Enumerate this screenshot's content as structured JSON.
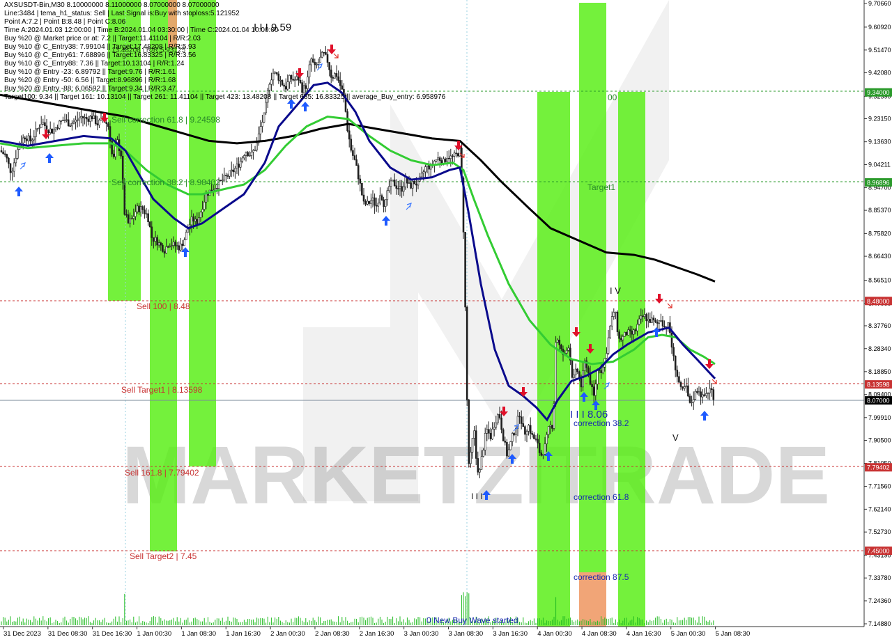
{
  "header": {
    "lines": [
      "AXSUSDT-Bin,M30  8.10000000 8.11000000 8.07000000 8.07000000",
      "Line:3484 | tema_h1_status: Sell | Last Signal is:Buy with stoploss:5.121952",
      "Point A:7.2 | Point B:8.48 | Point C:8.06",
      "Time A:2024.01.03 12:00:00 | Time B:2024.01.04 03:30:00 | Time C:2024.01.04 10:00:00",
      "Buy %20 @ Market price or at: 7.2 || Target:11.41104 | R/R:2.03",
      "Buy %10 @ C_Entry38: 7.99104 || Target:17.48208 | R/R:5.93",
      "Buy %10 @ C_Entry61: 7.68896 || Target:16.83325 | R/R:3.56",
      "Buy %10 @ C_Entry88: 7.36 || Target:10.13104 | R/R:1.24",
      "Buy %10 @ Entry -23: 6.89792 || Target:9.76 | R/R:1.61",
      "Buy %20 @ Entry -50: 6.56 || Target:8.96896 | R/R:1.68",
      "Buy %20 @ Entry -88: 6.06592 || Target:9.34 | R/R:3.47",
      "Target100: 9.34 || Target 161: 10.13104 || Target 261: 11.41104 || Target 423: 13.48208 || Target 685: 16.83325 || average_Buy_entry: 6.958976"
    ],
    "overlap_fragment": "13.48208 | R/R:5.93125"
  },
  "colors": {
    "bull_candle": "#1f1f1f",
    "bear_candle": "#1f1f1f",
    "ema_fast": "#0a0a8c",
    "ema_mid": "#33cc33",
    "ema_slow": "#000000",
    "green_zone": "#55ee11",
    "orange_zone": "#f0a070",
    "level_red": "#c83232",
    "level_green": "#2a9a2a",
    "buy_arrow": "#1e5aff",
    "sell_arrow": "#e0102a",
    "current_price_bg": "#000000"
  },
  "price_axis": {
    "ticks": [
      "9.70660",
      "9.60920",
      "9.51470",
      "9.42080",
      "9.32390",
      "9.23150",
      "9.13630",
      "9.04211",
      "8.94700",
      "8.85370",
      "8.75820",
      "8.66430",
      "8.56510",
      "8.47000",
      "8.37760",
      "8.28340",
      "8.18850",
      "8.09400",
      "7.99910",
      "7.90500",
      "7.81050",
      "7.71560",
      "7.62140",
      "7.52730",
      "7.43190",
      "7.33780",
      "7.24360",
      "7.14880"
    ],
    "badges": [
      {
        "label": "9.34000",
        "style": "green"
      },
      {
        "label": "8.96896",
        "style": "green"
      },
      {
        "label": "8.48000",
        "style": "red"
      },
      {
        "label": "8.13598",
        "style": "red"
      },
      {
        "label": "8.07000",
        "style": "black"
      },
      {
        "label": "7.79402",
        "style": "red"
      },
      {
        "label": "7.45000",
        "style": "red"
      }
    ]
  },
  "time_axis": {
    "labels": [
      "31 Dec 2023",
      "31 Dec 08:30",
      "31 Dec 16:30",
      "1 Jan 00:30",
      "1 Jan 08:30",
      "1 Jan 16:30",
      "2 Jan 00:30",
      "2 Jan 08:30",
      "2 Jan 16:30",
      "3 Jan 00:30",
      "3 Jan 08:30",
      "3 Jan 16:30",
      "4 Jan 00:30",
      "4 Jan 08:30",
      "4 Jan 16:30",
      "5 Jan 00:30",
      "5 Jan 08:30"
    ]
  },
  "annotations": {
    "sell_correction_618": "Sell correction 61.8 | 9.24598",
    "sell_correction_382": "Sell correction 38.2 | 8.98402",
    "sell_100": "Sell 100 | 8.48",
    "sell_target1": "Sell Target1 | 8.13598",
    "sell_1618": "Sell 161.8 | 7.79402",
    "sell_target2": "Sell Target2 | 7.45",
    "peak_label": "I I I 9.59",
    "target1": "Target1",
    "target_partial": "00",
    "point_c": "I I I 8.06",
    "correction_382": "correction 38.2",
    "correction_618": "correction 61.8",
    "correction_875": "correction 87.5",
    "new_wave": "0 New Buy Wave started",
    "marker_v_top": "I V",
    "marker_v_low": "V",
    "marker_iii_low": "I I I"
  },
  "watermark": "MARKETZITRADE",
  "chart_data": {
    "type": "candlestick",
    "symbol": "AXSUSDT-Bin",
    "timeframe": "M30",
    "ohlc_last": {
      "open": 8.1,
      "high": 8.11,
      "low": 8.07,
      "close": 8.07
    },
    "ylim": [
      7.1488,
      9.7066
    ],
    "levels": [
      {
        "name": "Target100",
        "value": 9.34
      },
      {
        "name": "Sell correction 61.8",
        "value": 9.24598
      },
      {
        "name": "Sell correction 38.2",
        "value": 8.98402
      },
      {
        "name": "Sell 100",
        "value": 8.48
      },
      {
        "name": "Sell Target1",
        "value": 8.13598
      },
      {
        "name": "Sell 161.8",
        "value": 7.79402
      },
      {
        "name": "Sell Target2",
        "value": 7.45
      }
    ],
    "close_path": [
      [
        0,
        9.1
      ],
      [
        8,
        9.08
      ],
      [
        16,
        9.01
      ],
      [
        22,
        9.07
      ],
      [
        28,
        9.13
      ],
      [
        36,
        9.16
      ],
      [
        44,
        9.14
      ],
      [
        52,
        9.18
      ],
      [
        60,
        9.22
      ],
      [
        68,
        9.19
      ],
      [
        76,
        9.18
      ],
      [
        84,
        9.21
      ],
      [
        92,
        9.23
      ],
      [
        100,
        9.21
      ],
      [
        108,
        9.22
      ],
      [
        116,
        9.24
      ],
      [
        124,
        9.23
      ],
      [
        132,
        9.24
      ],
      [
        140,
        9.21
      ],
      [
        148,
        9.23
      ],
      [
        156,
        9.2
      ],
      [
        162,
        9.05
      ],
      [
        168,
        9.14
      ],
      [
        174,
        9.08
      ],
      [
        178,
        8.85
      ],
      [
        184,
        8.8
      ],
      [
        190,
        8.82
      ],
      [
        196,
        8.86
      ],
      [
        204,
        8.86
      ],
      [
        212,
        8.83
      ],
      [
        218,
        8.74
      ],
      [
        224,
        8.73
      ],
      [
        230,
        8.71
      ],
      [
        236,
        8.69
      ],
      [
        242,
        8.72
      ],
      [
        250,
        8.71
      ],
      [
        258,
        8.7
      ],
      [
        264,
        8.73
      ],
      [
        270,
        8.78
      ],
      [
        276,
        8.82
      ],
      [
        282,
        8.8
      ],
      [
        288,
        8.85
      ],
      [
        296,
        8.92
      ],
      [
        304,
        8.94
      ],
      [
        312,
        8.96
      ],
      [
        320,
        8.98
      ],
      [
        328,
        9.0
      ],
      [
        336,
        9.02
      ],
      [
        344,
        9.05
      ],
      [
        352,
        9.1
      ],
      [
        360,
        9.08
      ],
      [
        368,
        9.12
      ],
      [
        374,
        9.2
      ],
      [
        380,
        9.25
      ],
      [
        386,
        9.38
      ],
      [
        392,
        9.42
      ],
      [
        398,
        9.41
      ],
      [
        404,
        9.38
      ],
      [
        410,
        9.36
      ],
      [
        416,
        9.4
      ],
      [
        422,
        9.39
      ],
      [
        428,
        9.4
      ],
      [
        434,
        9.35
      ],
      [
        440,
        9.37
      ],
      [
        446,
        9.48
      ],
      [
        452,
        9.44
      ],
      [
        458,
        9.47
      ],
      [
        464,
        9.5
      ],
      [
        470,
        9.47
      ],
      [
        476,
        9.4
      ],
      [
        482,
        9.42
      ],
      [
        488,
        9.37
      ],
      [
        494,
        9.32
      ],
      [
        498,
        9.2
      ],
      [
        504,
        9.1
      ],
      [
        510,
        9.05
      ],
      [
        516,
        8.97
      ],
      [
        522,
        8.88
      ],
      [
        528,
        8.88
      ],
      [
        534,
        8.9
      ],
      [
        540,
        8.87
      ],
      [
        546,
        8.93
      ],
      [
        552,
        8.87
      ],
      [
        558,
        8.95
      ],
      [
        564,
        8.97
      ],
      [
        570,
        8.95
      ],
      [
        576,
        8.94
      ],
      [
        582,
        8.98
      ],
      [
        588,
        8.95
      ],
      [
        594,
        8.97
      ],
      [
        600,
        8.96
      ],
      [
        606,
        9.0
      ],
      [
        612,
        9.04
      ],
      [
        618,
        9.03
      ],
      [
        624,
        9.06
      ],
      [
        630,
        9.07
      ],
      [
        636,
        9.05
      ],
      [
        642,
        9.08
      ],
      [
        648,
        9.07
      ],
      [
        654,
        9.08
      ],
      [
        660,
        9.1
      ],
      [
        664,
        8.9
      ],
      [
        668,
        8.4
      ],
      [
        672,
        7.8
      ],
      [
        676,
        7.85
      ],
      [
        680,
        7.96
      ],
      [
        684,
        7.8
      ],
      [
        688,
        7.77
      ],
      [
        692,
        7.85
      ],
      [
        698,
        7.95
      ],
      [
        704,
        7.92
      ],
      [
        710,
        7.98
      ],
      [
        716,
        8.02
      ],
      [
        722,
        7.92
      ],
      [
        728,
        7.84
      ],
      [
        734,
        7.91
      ],
      [
        740,
        7.96
      ],
      [
        746,
        8.02
      ],
      [
        752,
        7.93
      ],
      [
        758,
        7.97
      ],
      [
        764,
        7.92
      ],
      [
        770,
        7.9
      ],
      [
        776,
        7.84
      ],
      [
        782,
        7.88
      ],
      [
        788,
        7.96
      ],
      [
        794,
        7.97
      ],
      [
        798,
        8.35
      ],
      [
        804,
        8.28
      ],
      [
        810,
        8.25
      ],
      [
        816,
        8.3
      ],
      [
        822,
        8.15
      ],
      [
        828,
        8.2
      ],
      [
        834,
        8.13
      ],
      [
        840,
        8.24
      ],
      [
        846,
        8.16
      ],
      [
        852,
        8.08
      ],
      [
        858,
        8.21
      ],
      [
        864,
        8.19
      ],
      [
        870,
        8.27
      ],
      [
        876,
        8.38
      ],
      [
        882,
        8.45
      ],
      [
        888,
        8.32
      ],
      [
        894,
        8.33
      ],
      [
        900,
        8.35
      ],
      [
        906,
        8.34
      ],
      [
        912,
        8.36
      ],
      [
        918,
        8.4
      ],
      [
        924,
        8.42
      ],
      [
        930,
        8.4
      ],
      [
        936,
        8.4
      ],
      [
        942,
        8.38
      ],
      [
        948,
        8.41
      ],
      [
        954,
        8.37
      ],
      [
        960,
        8.38
      ],
      [
        966,
        8.25
      ],
      [
        972,
        8.17
      ],
      [
        978,
        8.1
      ],
      [
        984,
        8.13
      ],
      [
        990,
        8.05
      ],
      [
        996,
        8.09
      ],
      [
        1002,
        8.12
      ],
      [
        1008,
        8.08
      ],
      [
        1014,
        8.1
      ],
      [
        1020,
        8.12
      ],
      [
        1026,
        8.07
      ]
    ],
    "ema_fast_path": [
      [
        0,
        9.14
      ],
      [
        40,
        9.12
      ],
      [
        80,
        9.14
      ],
      [
        120,
        9.16
      ],
      [
        160,
        9.15
      ],
      [
        180,
        9.1
      ],
      [
        200,
        9.0
      ],
      [
        220,
        8.9
      ],
      [
        250,
        8.82
      ],
      [
        270,
        8.78
      ],
      [
        290,
        8.8
      ],
      [
        320,
        8.86
      ],
      [
        350,
        8.92
      ],
      [
        380,
        9.05
      ],
      [
        400,
        9.2
      ],
      [
        430,
        9.3
      ],
      [
        450,
        9.37
      ],
      [
        470,
        9.38
      ],
      [
        490,
        9.34
      ],
      [
        510,
        9.26
      ],
      [
        530,
        9.14
      ],
      [
        560,
        9.03
      ],
      [
        590,
        8.98
      ],
      [
        620,
        8.99
      ],
      [
        645,
        9.02
      ],
      [
        660,
        9.03
      ],
      [
        672,
        8.85
      ],
      [
        690,
        8.55
      ],
      [
        710,
        8.28
      ],
      [
        730,
        8.13
      ],
      [
        750,
        8.09
      ],
      [
        770,
        8.04
      ],
      [
        785,
        7.99
      ],
      [
        800,
        8.07
      ],
      [
        820,
        8.15
      ],
      [
        840,
        8.17
      ],
      [
        860,
        8.2
      ],
      [
        880,
        8.26
      ],
      [
        900,
        8.3
      ],
      [
        930,
        8.35
      ],
      [
        960,
        8.37
      ],
      [
        980,
        8.3
      ],
      [
        1000,
        8.24
      ],
      [
        1026,
        8.16
      ]
    ],
    "ema_mid_path": [
      [
        0,
        9.13
      ],
      [
        40,
        9.11
      ],
      [
        80,
        9.12
      ],
      [
        120,
        9.13
      ],
      [
        160,
        9.13
      ],
      [
        180,
        9.1
      ],
      [
        210,
        9.02
      ],
      [
        240,
        8.96
      ],
      [
        270,
        8.92
      ],
      [
        290,
        8.92
      ],
      [
        320,
        8.94
      ],
      [
        350,
        8.96
      ],
      [
        380,
        9.02
      ],
      [
        410,
        9.12
      ],
      [
        440,
        9.2
      ],
      [
        470,
        9.24
      ],
      [
        500,
        9.23
      ],
      [
        530,
        9.16
      ],
      [
        560,
        9.1
      ],
      [
        590,
        9.06
      ],
      [
        620,
        9.04
      ],
      [
        650,
        9.05
      ],
      [
        665,
        9.02
      ],
      [
        680,
        8.9
      ],
      [
        700,
        8.75
      ],
      [
        730,
        8.55
      ],
      [
        760,
        8.4
      ],
      [
        790,
        8.3
      ],
      [
        820,
        8.24
      ],
      [
        850,
        8.22
      ],
      [
        880,
        8.23
      ],
      [
        910,
        8.28
      ],
      [
        930,
        8.33
      ],
      [
        950,
        8.34
      ],
      [
        970,
        8.33
      ],
      [
        990,
        8.28
      ],
      [
        1010,
        8.25
      ],
      [
        1026,
        8.22
      ]
    ],
    "ema_slow_path": [
      [
        0,
        9.33
      ],
      [
        60,
        9.3
      ],
      [
        120,
        9.27
      ],
      [
        180,
        9.24
      ],
      [
        240,
        9.19
      ],
      [
        300,
        9.14
      ],
      [
        340,
        9.13
      ],
      [
        380,
        9.14
      ],
      [
        420,
        9.16
      ],
      [
        460,
        9.19
      ],
      [
        500,
        9.21
      ],
      [
        540,
        9.19
      ],
      [
        580,
        9.17
      ],
      [
        620,
        9.15
      ],
      [
        660,
        9.14
      ],
      [
        690,
        9.06
      ],
      [
        720,
        8.97
      ],
      [
        760,
        8.86
      ],
      [
        790,
        8.78
      ],
      [
        830,
        8.73
      ],
      [
        870,
        8.68
      ],
      [
        910,
        8.67
      ],
      [
        940,
        8.65
      ],
      [
        970,
        8.62
      ],
      [
        1000,
        8.59
      ],
      [
        1026,
        8.56
      ]
    ]
  }
}
